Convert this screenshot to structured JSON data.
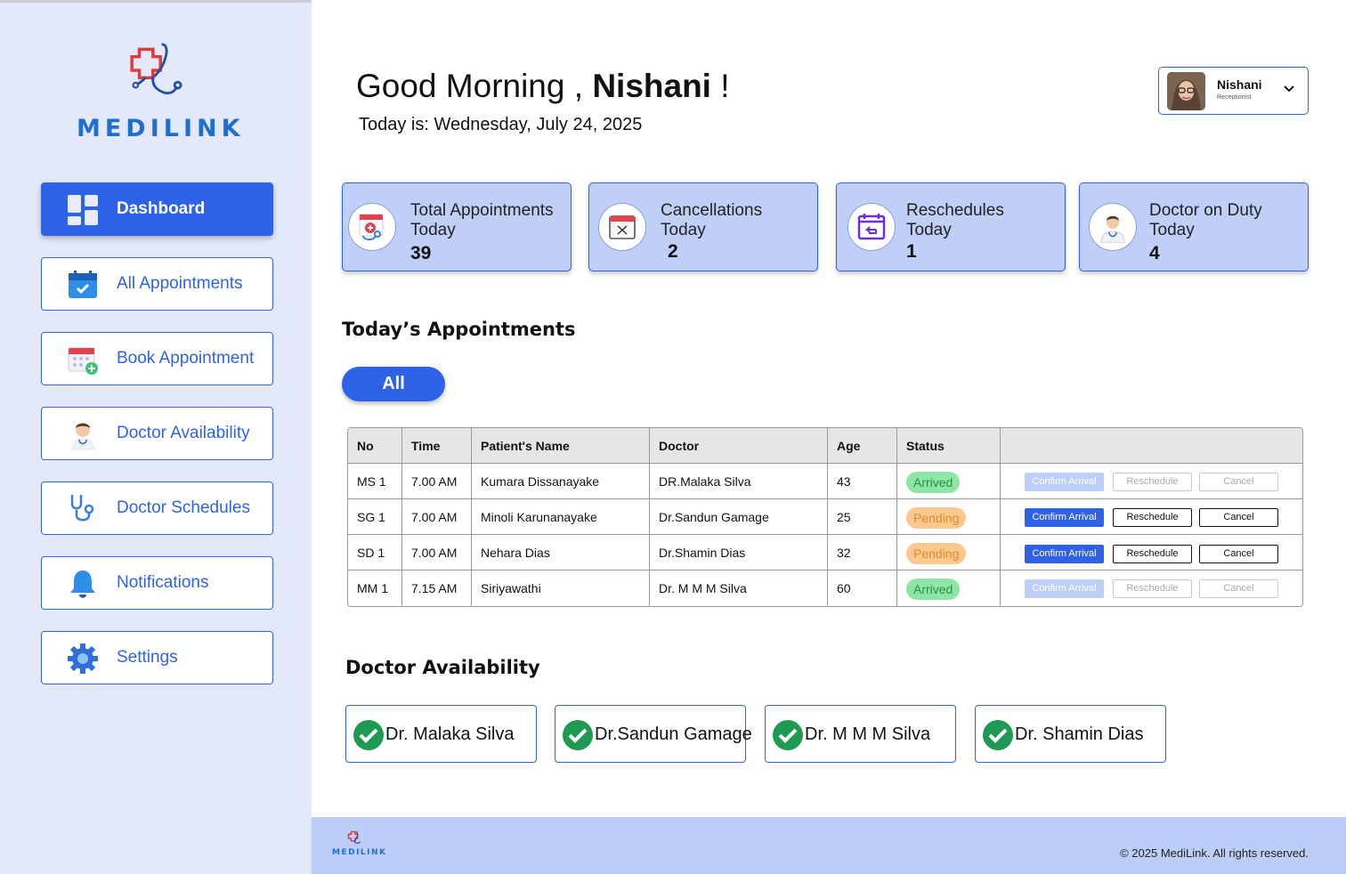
{
  "app": {
    "name": "MEDILINK"
  },
  "colors": {
    "primary": "#2e63e8",
    "sidebar_bg": "#e3e8fb",
    "card_bg": "#bfcff7",
    "arrived": "#8ee6a5",
    "pending": "#fbc88e"
  },
  "sidebar": {
    "items": [
      {
        "label": "Dashboard",
        "icon": "dashboard-icon",
        "active": true
      },
      {
        "label": "All Appointments",
        "icon": "calendar-check-icon"
      },
      {
        "label": "Book Appointment",
        "icon": "calendar-add-icon"
      },
      {
        "label": "Doctor Availability",
        "icon": "doctor-icon"
      },
      {
        "label": "Doctor Schedules",
        "icon": "stethoscope-icon"
      },
      {
        "label": "Notifications",
        "icon": "bell-icon"
      },
      {
        "label": "Settings",
        "icon": "gear-icon"
      }
    ]
  },
  "header": {
    "greeting_prefix": "Good Morning ,",
    "user_name": "Nishani",
    "greeting_suffix": "!",
    "today_text": "Today is: Wednesday, July 24, 2025"
  },
  "profile": {
    "name": "Nishani",
    "role": "Receptionist"
  },
  "stats": [
    {
      "label_line1": "Total Appointments",
      "label_line2": "Today",
      "value": "39",
      "icon": "appointment-medical-icon"
    },
    {
      "label_line1": "Cancellations",
      "label_line2": "Today",
      "value": "2",
      "icon": "calendar-cancel-icon"
    },
    {
      "label_line1": "Reschedules",
      "label_line2": "Today",
      "value": "1",
      "icon": "calendar-reschedule-icon"
    },
    {
      "label_line1": "Doctor on Duty",
      "label_line2": "Today",
      "value": "4",
      "icon": "doctor-icon"
    }
  ],
  "appointments": {
    "title": "Today’s Appointments",
    "filter_label": "All",
    "columns": [
      "No",
      "Time",
      "Patient's Name",
      "Doctor",
      "Age",
      "Status"
    ],
    "rows": [
      {
        "no": "MS 1",
        "time": "7.00 AM",
        "patient": "Kumara Dissanayake",
        "doctor": "DR.Malaka Silva",
        "age": "43",
        "status": "Arrived"
      },
      {
        "no": "SG 1",
        "time": "7.00 AM",
        "patient": "Minoli Karunanayake",
        "doctor": "Dr.Sandun Gamage",
        "age": "25",
        "status": "Pending"
      },
      {
        "no": "SD 1",
        "time": "7.00 AM",
        "patient": "Nehara Dias",
        "doctor": "Dr.Shamin Dias",
        "age": "32",
        "status": "Pending"
      },
      {
        "no": "MM 1",
        "time": "7.15 AM",
        "patient": "Siriyawathi",
        "doctor": "Dr. M M M Silva",
        "age": "60",
        "status": "Arrived"
      }
    ],
    "actions": {
      "confirm": "Confirm Arrival",
      "reschedule": "Reschedule",
      "cancel": "Cancel"
    }
  },
  "doctor_availability": {
    "title": "Doctor Availability",
    "doctors": [
      "Dr. Malaka Silva",
      "Dr.Sandun Gamage",
      "Dr. M M M Silva",
      "Dr. Shamin Dias"
    ]
  },
  "footer": {
    "logo_text": "MEDILINK",
    "copyright": "© 2025 MediLink. All rights reserved."
  }
}
